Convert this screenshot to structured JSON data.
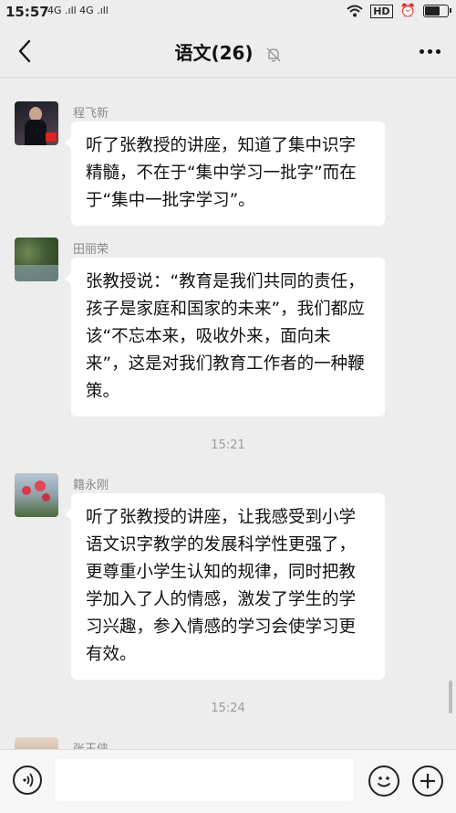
{
  "status_bar": {
    "time": "15:57",
    "signals": "4G .ıll 4G .ıll",
    "hd": "HD",
    "battery_level": 0.72
  },
  "nav": {
    "title": "语文(26)"
  },
  "messages": [
    {
      "sender": "程飞新",
      "text": "听了张教授的讲座，知道了集中识字精髓，不在于“集中学习一批字”而在于“集中一批字学习”。"
    },
    {
      "sender": "田丽荣",
      "text": "张教授说：“教育是我们共同的责任，孩子是家庭和国家的未来”，我们都应该“不忘本来，吸收外来，面向未来”，这是对我们教育工作者的一种鞭策。"
    },
    {
      "timestamp": "15:21"
    },
    {
      "sender": "籍永刚",
      "text": "听了张教授的讲座，让我感受到小学语文识字教学的发展科学性更强了，更尊重小学生认知的规律，同时把教学加入了人的情感，激发了学生的学习兴趣，参入情感的学习会使学习更有效。"
    },
    {
      "timestamp": "15:24"
    },
    {
      "sender": "张玉侠"
    }
  ],
  "input": {
    "placeholder": "",
    "value": ""
  },
  "colors": {
    "background": "#ededed",
    "bubble": "#ffffff"
  }
}
